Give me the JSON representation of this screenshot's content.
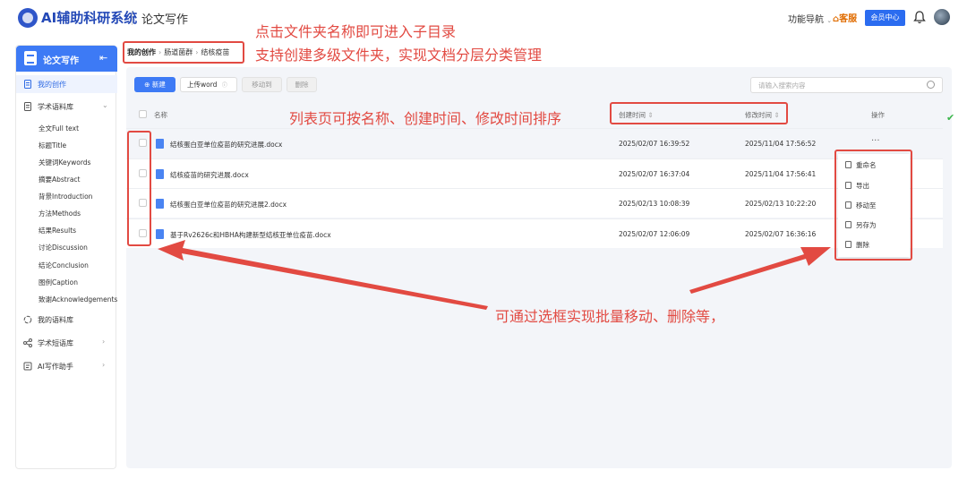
{
  "header": {
    "brand": "AI辅助科研系统",
    "module": "论文写作",
    "func_nav": "功能导航",
    "service": "客服",
    "member": "会员中心"
  },
  "sidebar": {
    "title": "论文写作",
    "items": [
      {
        "label": "我的创作",
        "active": true
      },
      {
        "label": "学术语料库"
      },
      {
        "label": "我的语料库"
      },
      {
        "label": "学术短语库"
      },
      {
        "label": "AI写作助手"
      }
    ],
    "subitems": [
      "全文Full text",
      "标题Title",
      "关键词Keywords",
      "摘要Abstract",
      "背景Introduction",
      "方法Methods",
      "结果Results",
      "讨论Discussion",
      "结论Conclusion",
      "图例Caption",
      "致谢Acknowledgements"
    ]
  },
  "breadcrumb": {
    "root": "我的创作",
    "level1": "肠道菌群",
    "level2": "结核疫苗"
  },
  "toolbar": {
    "new_label": "新建",
    "upload_label": "上传word",
    "move_label": "移动到",
    "delete_label": "删除",
    "search_placeholder": "请输入搜索内容"
  },
  "table": {
    "col_name": "名称",
    "col_created": "创建时间",
    "col_modified": "修改时间",
    "col_ops": "操作",
    "rows": [
      {
        "name": "结核蛋白亚单位疫苗的研究进展.docx",
        "created": "2025/02/07 16:39:52",
        "modified": "2025/11/04 17:56:52"
      },
      {
        "name": "结核疫苗的研究进展.docx",
        "created": "2025/02/07 16:37:04",
        "modified": "2025/11/04 17:56:41"
      },
      {
        "name": "结核蛋白亚单位疫苗的研究进展2.docx",
        "created": "2025/02/13 10:08:39",
        "modified": "2025/02/13 10:22:20"
      },
      {
        "name": "基于Rv2626c和HBHA构建新型结核亚单位疫苗.docx",
        "created": "2025/02/07 12:06:09",
        "modified": "2025/02/07 16:36:16"
      }
    ],
    "more": "···"
  },
  "menu": {
    "items": [
      "重命名",
      "导出",
      "移动至",
      "另存为",
      "删除"
    ]
  },
  "annotations": {
    "line1": "点击文件夹名称即可进入子目录",
    "line2": "支持创建多级文件夹，实现文档分层分类管理",
    "sort": "列表页可按名称、创建时间、修改时间排序",
    "batch": "可通过选框实现批量移动、删除等，"
  },
  "colors": {
    "primary": "#3d7af5",
    "annotation_red": "#e24a42",
    "brand_blue": "#2449b7"
  }
}
